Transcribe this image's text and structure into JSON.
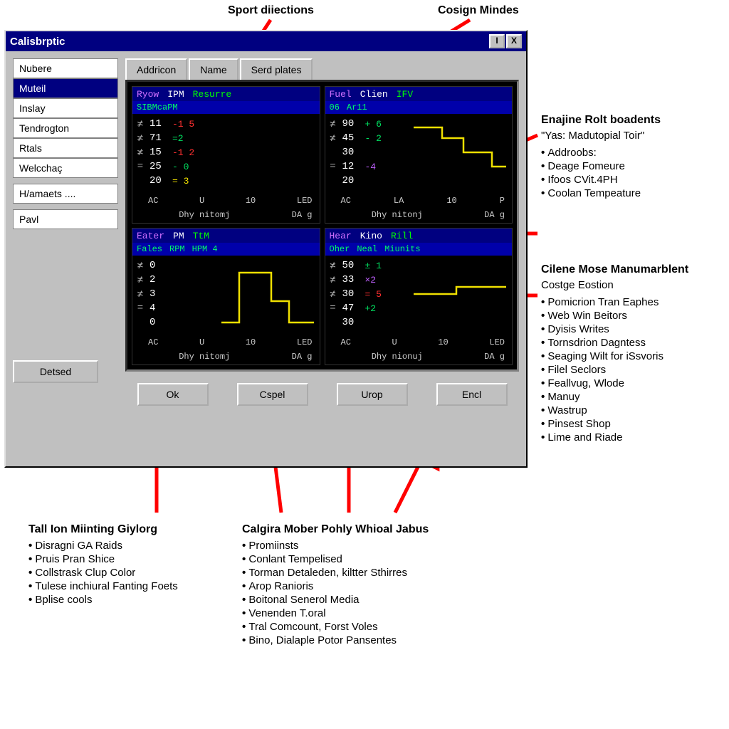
{
  "callouts": {
    "top1": "Sport diiections",
    "top2": "Cosign Mindes"
  },
  "window": {
    "title": "Calisbrptic",
    "min": "I",
    "close": "X",
    "sidebar": {
      "items": [
        {
          "label": "Nubere",
          "selected": false
        },
        {
          "label": "Muteil",
          "selected": true
        },
        {
          "label": "Inslay",
          "selected": false
        },
        {
          "label": "Tendrogton",
          "selected": false
        },
        {
          "label": "Rtals",
          "selected": false
        },
        {
          "label": "Welcchaç",
          "selected": false
        },
        {
          "label": "H/amaets  ....",
          "selected": false
        },
        {
          "label": "Pavl",
          "selected": false
        }
      ],
      "detailed": "Detsed"
    },
    "tabs": [
      {
        "label": "Addricon"
      },
      {
        "label": "Name"
      },
      {
        "label": "Serd plates"
      }
    ],
    "gauges": [
      {
        "hdr": [
          "Ryow",
          "IPM",
          "Resurre"
        ],
        "sub": [
          "SIBMcaPM"
        ],
        "rows": [
          {
            "sym": "≭",
            "v1": "11",
            "v2": "-1 5",
            "c": "c-red"
          },
          {
            "sym": "≭",
            "v1": "71",
            "v2": "=2",
            "c": "c-green"
          },
          {
            "sym": "≭",
            "v1": "15",
            "v2": "-1 2",
            "c": "c-red"
          },
          {
            "sym": "=",
            "v1": "25",
            "v2": "- 0",
            "c": "c-green"
          },
          {
            "sym": "",
            "v1": "20",
            "v2": "= 3",
            "c": "c-yellow"
          }
        ],
        "foot": [
          "AC",
          "U",
          "10",
          "LED"
        ],
        "foot2": [
          "",
          "Dhy nitomj",
          "",
          "DA g"
        ],
        "trace": false
      },
      {
        "hdr": [
          "Fuel",
          "Clien",
          "IFV"
        ],
        "sub": [
          "06",
          "Ar11"
        ],
        "rows": [
          {
            "sym": "≭",
            "v1": "90",
            "v2": "+ 6",
            "c": "c-green"
          },
          {
            "sym": "≭",
            "v1": "45",
            "v2": "- 2",
            "c": "c-green"
          },
          {
            "sym": "",
            "v1": "30",
            "v2": "",
            "c": "c-purple"
          },
          {
            "sym": "=",
            "v1": "12",
            "v2": "-4",
            "c": "c-purple"
          },
          {
            "sym": "",
            "v1": "20",
            "v2": "",
            "c": "c-white"
          }
        ],
        "foot": [
          "AC",
          "LA",
          "10",
          "P"
        ],
        "foot2": [
          "",
          "Dhy nitonj",
          "",
          "DA g"
        ],
        "trace": true
      },
      {
        "hdr": [
          "Eater",
          "PM",
          "TtM"
        ],
        "sub": [
          "Fales",
          "RPM",
          "HPM 4"
        ],
        "rows": [
          {
            "sym": "≭",
            "v1": "0",
            "v2": "",
            "c": "c-white"
          },
          {
            "sym": "≭",
            "v1": "2",
            "v2": "",
            "c": "c-white"
          },
          {
            "sym": "≭",
            "v1": "3",
            "v2": "",
            "c": "c-white"
          },
          {
            "sym": "=",
            "v1": "4",
            "v2": "",
            "c": "c-white"
          },
          {
            "sym": "",
            "v1": "0",
            "v2": "",
            "c": "c-white"
          }
        ],
        "foot": [
          "AC",
          "U",
          "10",
          "LED"
        ],
        "foot2": [
          "",
          "Dhy nitomj",
          "",
          "DA g"
        ],
        "trace": true
      },
      {
        "hdr": [
          "Hear",
          "Kino",
          "Rill"
        ],
        "sub": [
          "Oher",
          "Neal",
          "Miunits"
        ],
        "rows": [
          {
            "sym": "≭",
            "v1": "50",
            "v2": "± 1",
            "c": "c-green"
          },
          {
            "sym": "≭",
            "v1": "33",
            "v2": "×2",
            "c": "c-purple"
          },
          {
            "sym": "≭",
            "v1": "30",
            "v2": "= 5",
            "c": "c-red"
          },
          {
            "sym": "=",
            "v1": "47",
            "v2": "+2",
            "c": "c-green"
          },
          {
            "sym": "",
            "v1": "30",
            "v2": "",
            "c": "c-white"
          }
        ],
        "foot": [
          "AC",
          "U",
          "10",
          "LED"
        ],
        "foot2": [
          "",
          "Dhy nionuj",
          "",
          "DA g"
        ],
        "trace": true
      }
    ],
    "buttons": [
      "Ok",
      "Cspel",
      "Urop",
      "Encl"
    ]
  },
  "anno": {
    "right1": {
      "hdr": "Enajine Rolt boadents",
      "sub": "\"Yas: Madutopial Toir\"",
      "items": [
        "Addroobs:",
        "Deage Fomeure",
        "Ifoos CVit.4PH",
        "Coolan Tempeature"
      ]
    },
    "right2": {
      "hdr": "Cilene Mose Manumarblent",
      "sub": "Costge Eostion",
      "items": [
        "Pomicrion Tran Eaphes",
        "Web Win Beitors",
        "Dyisis Writes",
        "Tornsdrion Dagntess",
        "Seaging Wilt for iSsvoris",
        "Filel Seclors",
        "Feallvug, Wlode",
        "Manuy",
        "Wastrup",
        "Pinsest Shop",
        "Lime and Riade"
      ]
    },
    "bottom1": {
      "hdr": "Tall Ion Miinting Giylorg",
      "items": [
        "Disragni GA Raids",
        "Pruis Pran Shice",
        "Collstrask Clup Color",
        "Tulese inchiural Fanting Foets",
        "Bplise cools"
      ]
    },
    "bottom2": {
      "hdr": "Calgira Mober Pohly Whioal Jabus",
      "items": [
        "Promiinsts",
        "Conlant Tempelised",
        "Torman Detaleden, kiltter Sthirres",
        "Arop Ranioris",
        "Boitonal Senerol Media",
        "Venenden T.oral",
        "Tral Comcount, Forst Voles",
        "Bino, Dialaple Potor Pansentes"
      ]
    }
  }
}
